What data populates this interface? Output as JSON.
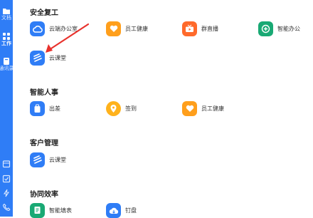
{
  "sidebar": {
    "items": [
      {
        "label": "文档"
      },
      {
        "label": "工作"
      },
      {
        "label": "通讯录"
      }
    ]
  },
  "sections": [
    {
      "title": "安全复工",
      "apps": [
        {
          "label": "云端办公室",
          "icon": "cloud-icon",
          "color": "#2f7df6"
        },
        {
          "label": "员工健康",
          "icon": "heart-icon",
          "color": "#ff9f1c"
        },
        {
          "label": "群直播",
          "icon": "live-tv-icon",
          "color": "#ff6a2b"
        },
        {
          "label": "智能办公",
          "icon": "smart-office-icon",
          "color": "#19a974"
        },
        {
          "label": "云课堂",
          "icon": "stripes-icon",
          "color": "#2f7df6"
        }
      ]
    },
    {
      "title": "智能人事",
      "apps": [
        {
          "label": "出差",
          "icon": "briefcase-icon",
          "color": "#2f7df6"
        },
        {
          "label": "签到",
          "icon": "location-pin-icon",
          "color": "#ffb21c"
        },
        {
          "label": "员工健康",
          "icon": "heart-icon",
          "color": "#ff9f1c"
        }
      ]
    },
    {
      "title": "客户管理",
      "apps": [
        {
          "label": "云课堂",
          "icon": "stripes-icon",
          "color": "#2f7df6"
        }
      ]
    },
    {
      "title": "协同效率",
      "apps": [
        {
          "label": "智能填表",
          "icon": "form-icon",
          "color": "#19a974"
        },
        {
          "label": "钉盘",
          "icon": "cloud-drive-icon",
          "color": "#2f7df6"
        }
      ]
    }
  ]
}
